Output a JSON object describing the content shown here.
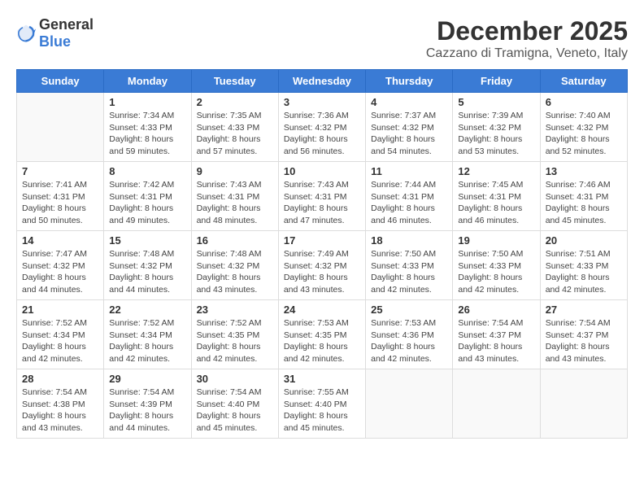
{
  "header": {
    "logo_general": "General",
    "logo_blue": "Blue",
    "month_title": "December 2025",
    "location": "Cazzano di Tramigna, Veneto, Italy"
  },
  "weekdays": [
    "Sunday",
    "Monday",
    "Tuesday",
    "Wednesday",
    "Thursday",
    "Friday",
    "Saturday"
  ],
  "weeks": [
    [
      {
        "day": "",
        "info": ""
      },
      {
        "day": "1",
        "info": "Sunrise: 7:34 AM\nSunset: 4:33 PM\nDaylight: 8 hours\nand 59 minutes."
      },
      {
        "day": "2",
        "info": "Sunrise: 7:35 AM\nSunset: 4:33 PM\nDaylight: 8 hours\nand 57 minutes."
      },
      {
        "day": "3",
        "info": "Sunrise: 7:36 AM\nSunset: 4:32 PM\nDaylight: 8 hours\nand 56 minutes."
      },
      {
        "day": "4",
        "info": "Sunrise: 7:37 AM\nSunset: 4:32 PM\nDaylight: 8 hours\nand 54 minutes."
      },
      {
        "day": "5",
        "info": "Sunrise: 7:39 AM\nSunset: 4:32 PM\nDaylight: 8 hours\nand 53 minutes."
      },
      {
        "day": "6",
        "info": "Sunrise: 7:40 AM\nSunset: 4:32 PM\nDaylight: 8 hours\nand 52 minutes."
      }
    ],
    [
      {
        "day": "7",
        "info": "Sunrise: 7:41 AM\nSunset: 4:31 PM\nDaylight: 8 hours\nand 50 minutes."
      },
      {
        "day": "8",
        "info": "Sunrise: 7:42 AM\nSunset: 4:31 PM\nDaylight: 8 hours\nand 49 minutes."
      },
      {
        "day": "9",
        "info": "Sunrise: 7:43 AM\nSunset: 4:31 PM\nDaylight: 8 hours\nand 48 minutes."
      },
      {
        "day": "10",
        "info": "Sunrise: 7:43 AM\nSunset: 4:31 PM\nDaylight: 8 hours\nand 47 minutes."
      },
      {
        "day": "11",
        "info": "Sunrise: 7:44 AM\nSunset: 4:31 PM\nDaylight: 8 hours\nand 46 minutes."
      },
      {
        "day": "12",
        "info": "Sunrise: 7:45 AM\nSunset: 4:31 PM\nDaylight: 8 hours\nand 46 minutes."
      },
      {
        "day": "13",
        "info": "Sunrise: 7:46 AM\nSunset: 4:31 PM\nDaylight: 8 hours\nand 45 minutes."
      }
    ],
    [
      {
        "day": "14",
        "info": "Sunrise: 7:47 AM\nSunset: 4:32 PM\nDaylight: 8 hours\nand 44 minutes."
      },
      {
        "day": "15",
        "info": "Sunrise: 7:48 AM\nSunset: 4:32 PM\nDaylight: 8 hours\nand 44 minutes."
      },
      {
        "day": "16",
        "info": "Sunrise: 7:48 AM\nSunset: 4:32 PM\nDaylight: 8 hours\nand 43 minutes."
      },
      {
        "day": "17",
        "info": "Sunrise: 7:49 AM\nSunset: 4:32 PM\nDaylight: 8 hours\nand 43 minutes."
      },
      {
        "day": "18",
        "info": "Sunrise: 7:50 AM\nSunset: 4:33 PM\nDaylight: 8 hours\nand 42 minutes."
      },
      {
        "day": "19",
        "info": "Sunrise: 7:50 AM\nSunset: 4:33 PM\nDaylight: 8 hours\nand 42 minutes."
      },
      {
        "day": "20",
        "info": "Sunrise: 7:51 AM\nSunset: 4:33 PM\nDaylight: 8 hours\nand 42 minutes."
      }
    ],
    [
      {
        "day": "21",
        "info": "Sunrise: 7:52 AM\nSunset: 4:34 PM\nDaylight: 8 hours\nand 42 minutes."
      },
      {
        "day": "22",
        "info": "Sunrise: 7:52 AM\nSunset: 4:34 PM\nDaylight: 8 hours\nand 42 minutes."
      },
      {
        "day": "23",
        "info": "Sunrise: 7:52 AM\nSunset: 4:35 PM\nDaylight: 8 hours\nand 42 minutes."
      },
      {
        "day": "24",
        "info": "Sunrise: 7:53 AM\nSunset: 4:35 PM\nDaylight: 8 hours\nand 42 minutes."
      },
      {
        "day": "25",
        "info": "Sunrise: 7:53 AM\nSunset: 4:36 PM\nDaylight: 8 hours\nand 42 minutes."
      },
      {
        "day": "26",
        "info": "Sunrise: 7:54 AM\nSunset: 4:37 PM\nDaylight: 8 hours\nand 43 minutes."
      },
      {
        "day": "27",
        "info": "Sunrise: 7:54 AM\nSunset: 4:37 PM\nDaylight: 8 hours\nand 43 minutes."
      }
    ],
    [
      {
        "day": "28",
        "info": "Sunrise: 7:54 AM\nSunset: 4:38 PM\nDaylight: 8 hours\nand 43 minutes."
      },
      {
        "day": "29",
        "info": "Sunrise: 7:54 AM\nSunset: 4:39 PM\nDaylight: 8 hours\nand 44 minutes."
      },
      {
        "day": "30",
        "info": "Sunrise: 7:54 AM\nSunset: 4:40 PM\nDaylight: 8 hours\nand 45 minutes."
      },
      {
        "day": "31",
        "info": "Sunrise: 7:55 AM\nSunset: 4:40 PM\nDaylight: 8 hours\nand 45 minutes."
      },
      {
        "day": "",
        "info": ""
      },
      {
        "day": "",
        "info": ""
      },
      {
        "day": "",
        "info": ""
      }
    ]
  ]
}
